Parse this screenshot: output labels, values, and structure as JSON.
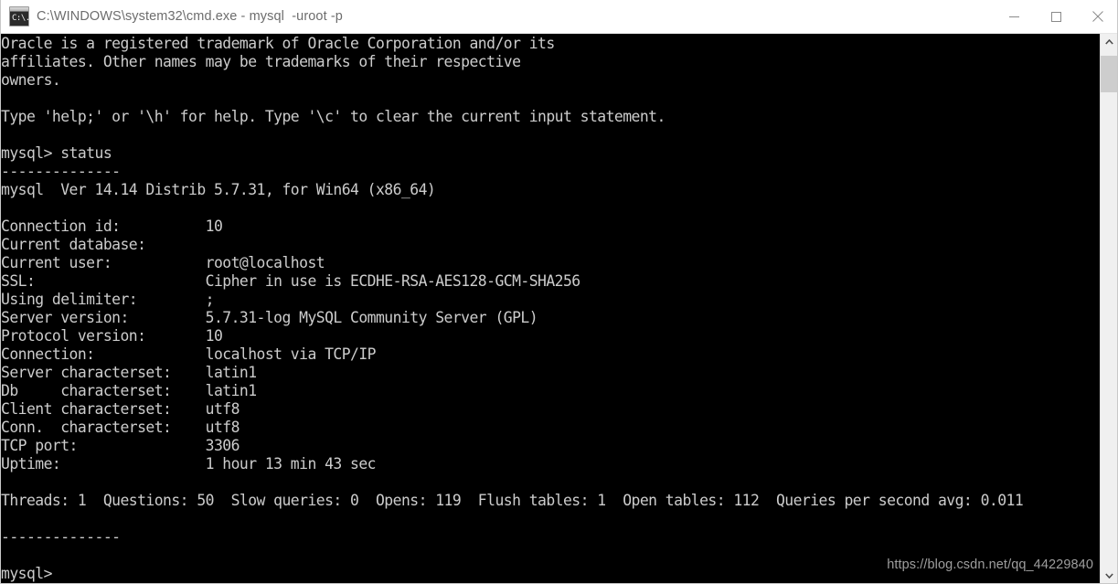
{
  "window": {
    "title": "C:\\WINDOWS\\system32\\cmd.exe - mysql  -uroot -p",
    "icon": "cmd-console-icon",
    "icon_text": "C:\\.",
    "controls": {
      "minimize_label": "Minimize",
      "maximize_label": "Maximize",
      "close_label": "Close"
    }
  },
  "console": {
    "background_color": "#000000",
    "text_color": "#cccccc",
    "lines": [
      "Oracle is a registered trademark of Oracle Corporation and/or its",
      "affiliates. Other names may be trademarks of their respective",
      "owners.",
      "",
      "Type 'help;' or '\\h' for help. Type '\\c' to clear the current input statement.",
      "",
      "mysql> status",
      "--------------",
      "mysql  Ver 14.14 Distrib 5.7.31, for Win64 (x86_64)",
      "",
      "Connection id:          10",
      "Current database:",
      "Current user:           root@localhost",
      "SSL:                    Cipher in use is ECDHE-RSA-AES128-GCM-SHA256",
      "Using delimiter:        ;",
      "Server version:         5.7.31-log MySQL Community Server (GPL)",
      "Protocol version:       10",
      "Connection:             localhost via TCP/IP",
      "Server characterset:    latin1",
      "Db     characterset:    latin1",
      "Client characterset:    utf8",
      "Conn.  characterset:    utf8",
      "TCP port:               3306",
      "Uptime:                 1 hour 13 min 43 sec",
      "",
      "Threads: 1  Questions: 50  Slow queries: 0  Opens: 119  Flush tables: 1  Open tables: 112  Queries per second avg: 0.011",
      "",
      "--------------",
      "",
      "mysql>"
    ],
    "status": {
      "command": "status",
      "prompt": "mysql>",
      "version_banner": "mysql  Ver 14.14 Distrib 5.7.31, for Win64 (x86_64)",
      "fields": [
        {
          "label": "Connection id:",
          "value": "10"
        },
        {
          "label": "Current database:",
          "value": ""
        },
        {
          "label": "Current user:",
          "value": "root@localhost"
        },
        {
          "label": "SSL:",
          "value": "Cipher in use is ECDHE-RSA-AES128-GCM-SHA256"
        },
        {
          "label": "Using delimiter:",
          "value": ";"
        },
        {
          "label": "Server version:",
          "value": "5.7.31-log MySQL Community Server (GPL)"
        },
        {
          "label": "Protocol version:",
          "value": "10"
        },
        {
          "label": "Connection:",
          "value": "localhost via TCP/IP"
        },
        {
          "label": "Server characterset:",
          "value": "latin1"
        },
        {
          "label": "Db     characterset:",
          "value": "latin1"
        },
        {
          "label": "Client characterset:",
          "value": "utf8"
        },
        {
          "label": "Conn.  characterset:",
          "value": "utf8"
        },
        {
          "label": "TCP port:",
          "value": "3306"
        },
        {
          "label": "Uptime:",
          "value": "1 hour 13 min 43 sec"
        }
      ],
      "counters": {
        "threads": "1",
        "questions": "50",
        "slow_queries": "0",
        "opens": "119",
        "flush_tables": "1",
        "open_tables": "112",
        "queries_per_second_avg": "0.011"
      }
    }
  },
  "scrollbar": {
    "up_icon": "chevron-up-icon",
    "down_icon": "chevron-down-icon"
  },
  "watermark": {
    "text": "https://blog.csdn.net/qq_44229840"
  }
}
